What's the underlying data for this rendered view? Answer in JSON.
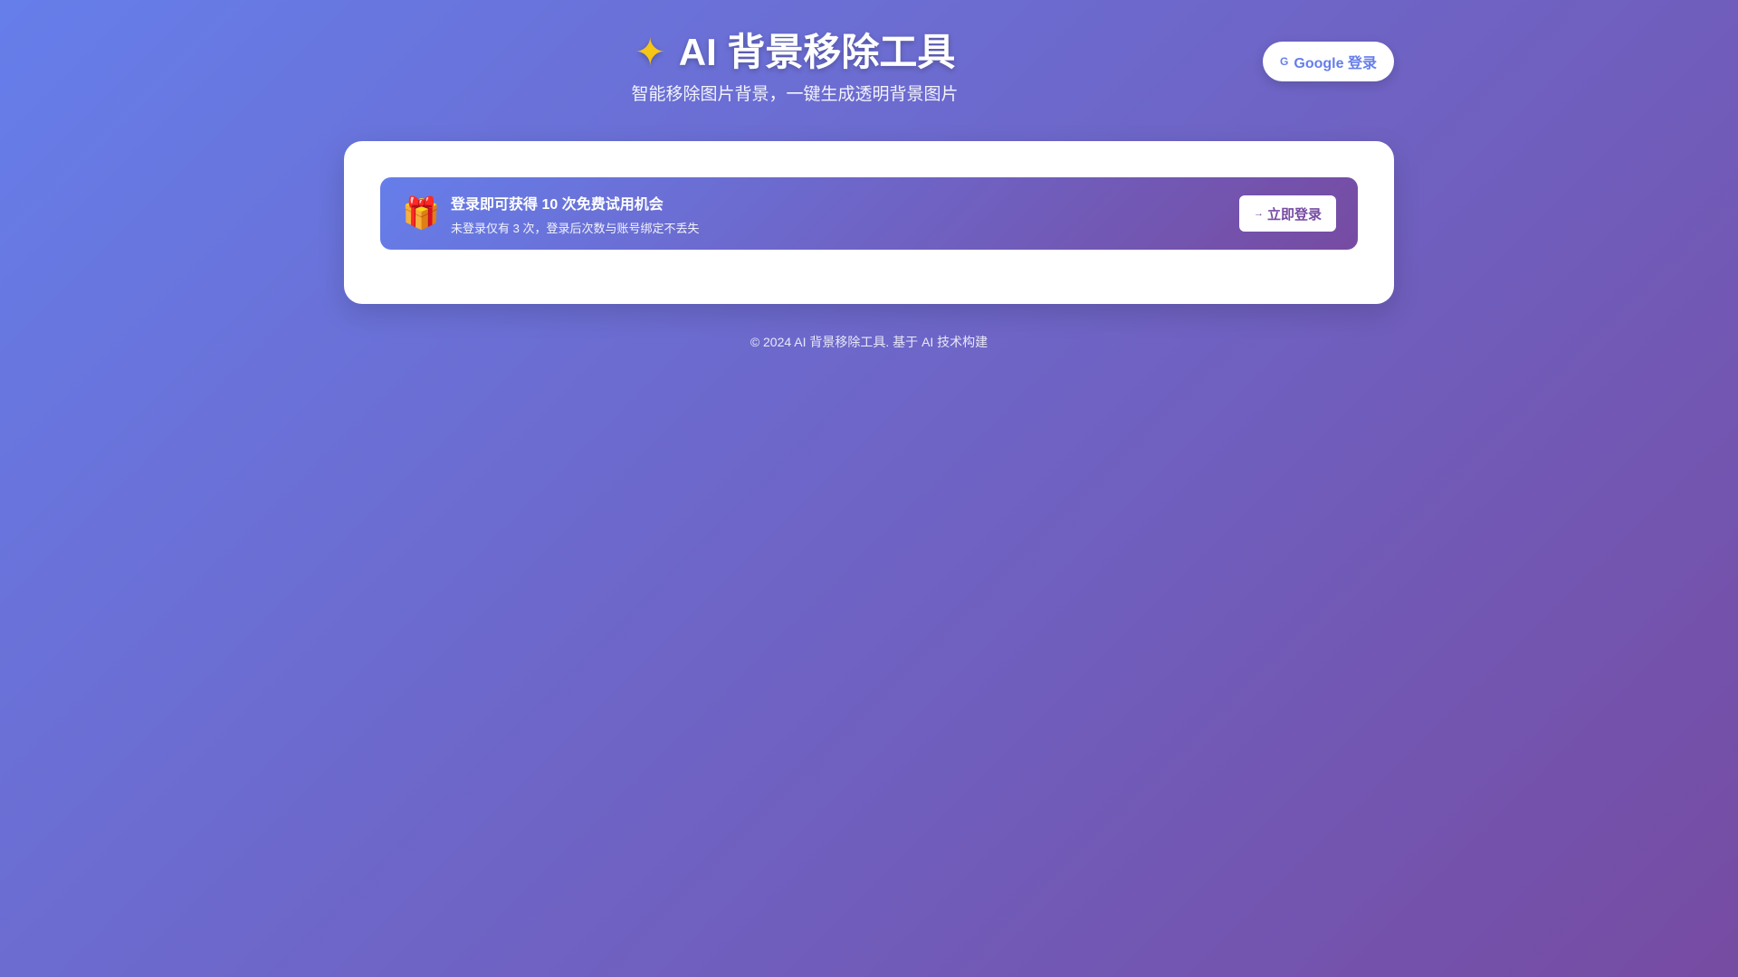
{
  "header": {
    "title_icon": "magic-icon",
    "title_icon_glyph": "✦",
    "title": "AI 背景移除工具",
    "subtitle": "智能移除图片背景，一键生成透明背景图片",
    "google_login_label": "Google 登录",
    "google_icon_glyph": "G"
  },
  "banner": {
    "gift_glyph": "🎁",
    "headline": "登录即可获得 10 次免费试用机会",
    "detail": "未登录仅有 3 次，登录后次数与账号绑定不丢失",
    "login_label": "立即登录",
    "login_icon_glyph": "→"
  },
  "footer": {
    "text": "© 2024 AI 背景移除工具. 基于 AI 技术构建"
  }
}
